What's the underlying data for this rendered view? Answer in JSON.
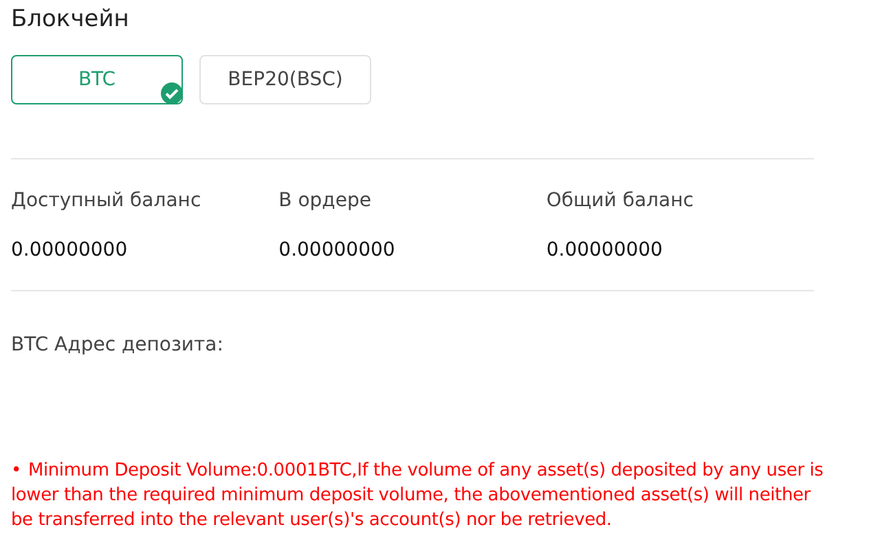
{
  "title": "Блокчейн",
  "networks": [
    {
      "label": "BTC",
      "selected": true
    },
    {
      "label": "BEP20(BSC)",
      "selected": false
    }
  ],
  "balances": [
    {
      "label": "Доступный баланс",
      "value": "0.00000000"
    },
    {
      "label": "В ордере",
      "value": "0.00000000"
    },
    {
      "label": "Общий баланс",
      "value": "0.00000000"
    }
  ],
  "deposit_address_label": "BTC Адрес депозита:",
  "notice": {
    "bullet": "•",
    "text": "Minimum Deposit Volume:0.0001BTC,If the volume of any asset(s) deposited by any user is lower than the required minimum deposit volume, the abovementioned asset(s) will neither be transferred into the relevant user(s)'s account(s) nor be retrieved."
  }
}
